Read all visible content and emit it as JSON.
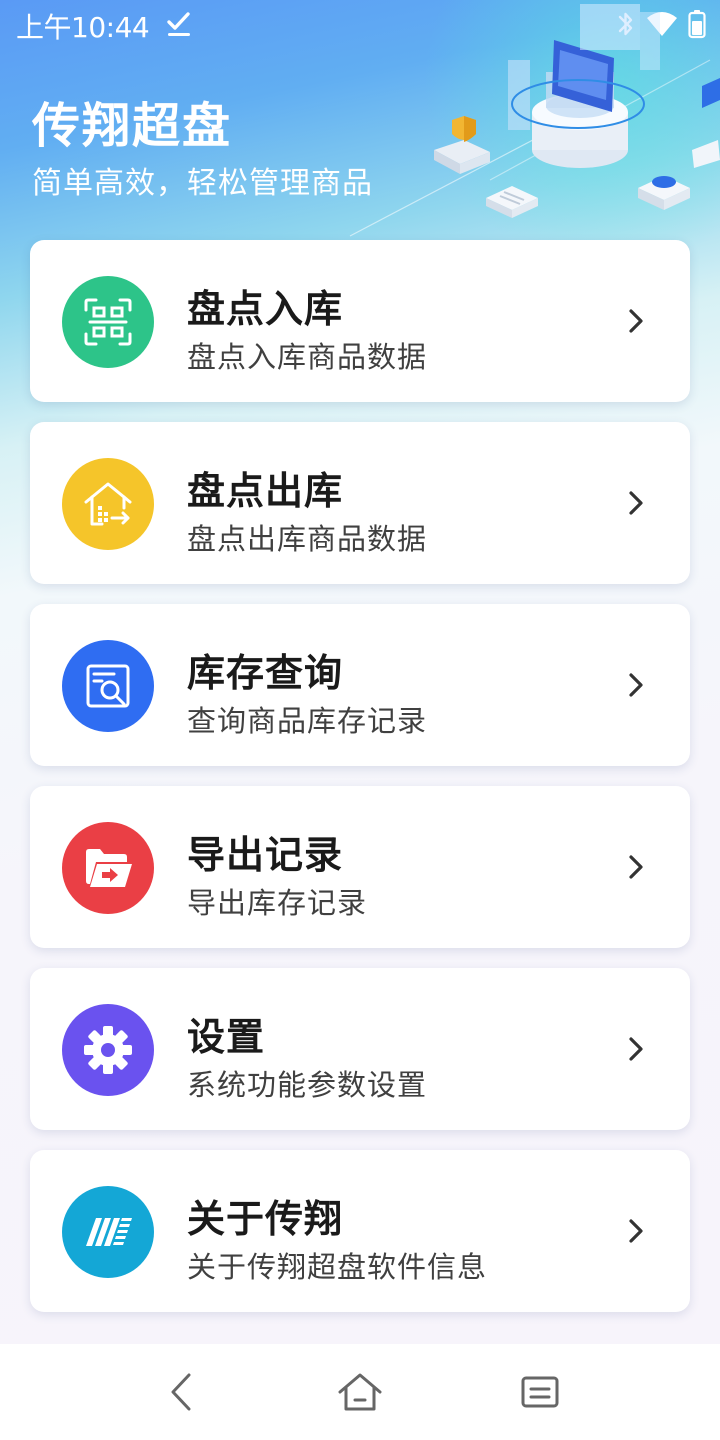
{
  "status_bar": {
    "time": "上午10:44",
    "icons": [
      "check-icon",
      "bluetooth-icon",
      "wifi-icon",
      "battery-icon"
    ]
  },
  "header": {
    "title": "传翔超盘",
    "subtitle": "简单高效，轻松管理商品"
  },
  "menu": {
    "items": [
      {
        "title": "盘点入库",
        "desc": "盘点入库商品数据",
        "icon": "scan-icon",
        "color": "#2dc489"
      },
      {
        "title": "盘点出库",
        "desc": "盘点出库商品数据",
        "icon": "warehouse-out-icon",
        "color": "#f5c52a"
      },
      {
        "title": "库存查询",
        "desc": "查询商品库存记录",
        "icon": "search-document-icon",
        "color": "#2f6df2"
      },
      {
        "title": "导出记录",
        "desc": "导出库存记录",
        "icon": "export-folder-icon",
        "color": "#ea3f45"
      },
      {
        "title": "设置",
        "desc": "系统功能参数设置",
        "icon": "gear-icon",
        "color": "#6a52ef"
      },
      {
        "title": "关于传翔",
        "desc": "关于传翔超盘软件信息",
        "icon": "brand-logo-icon",
        "color": "#14a7d6"
      }
    ]
  },
  "nav_bar": {
    "buttons": [
      "back-icon",
      "home-icon",
      "recents-icon"
    ]
  }
}
